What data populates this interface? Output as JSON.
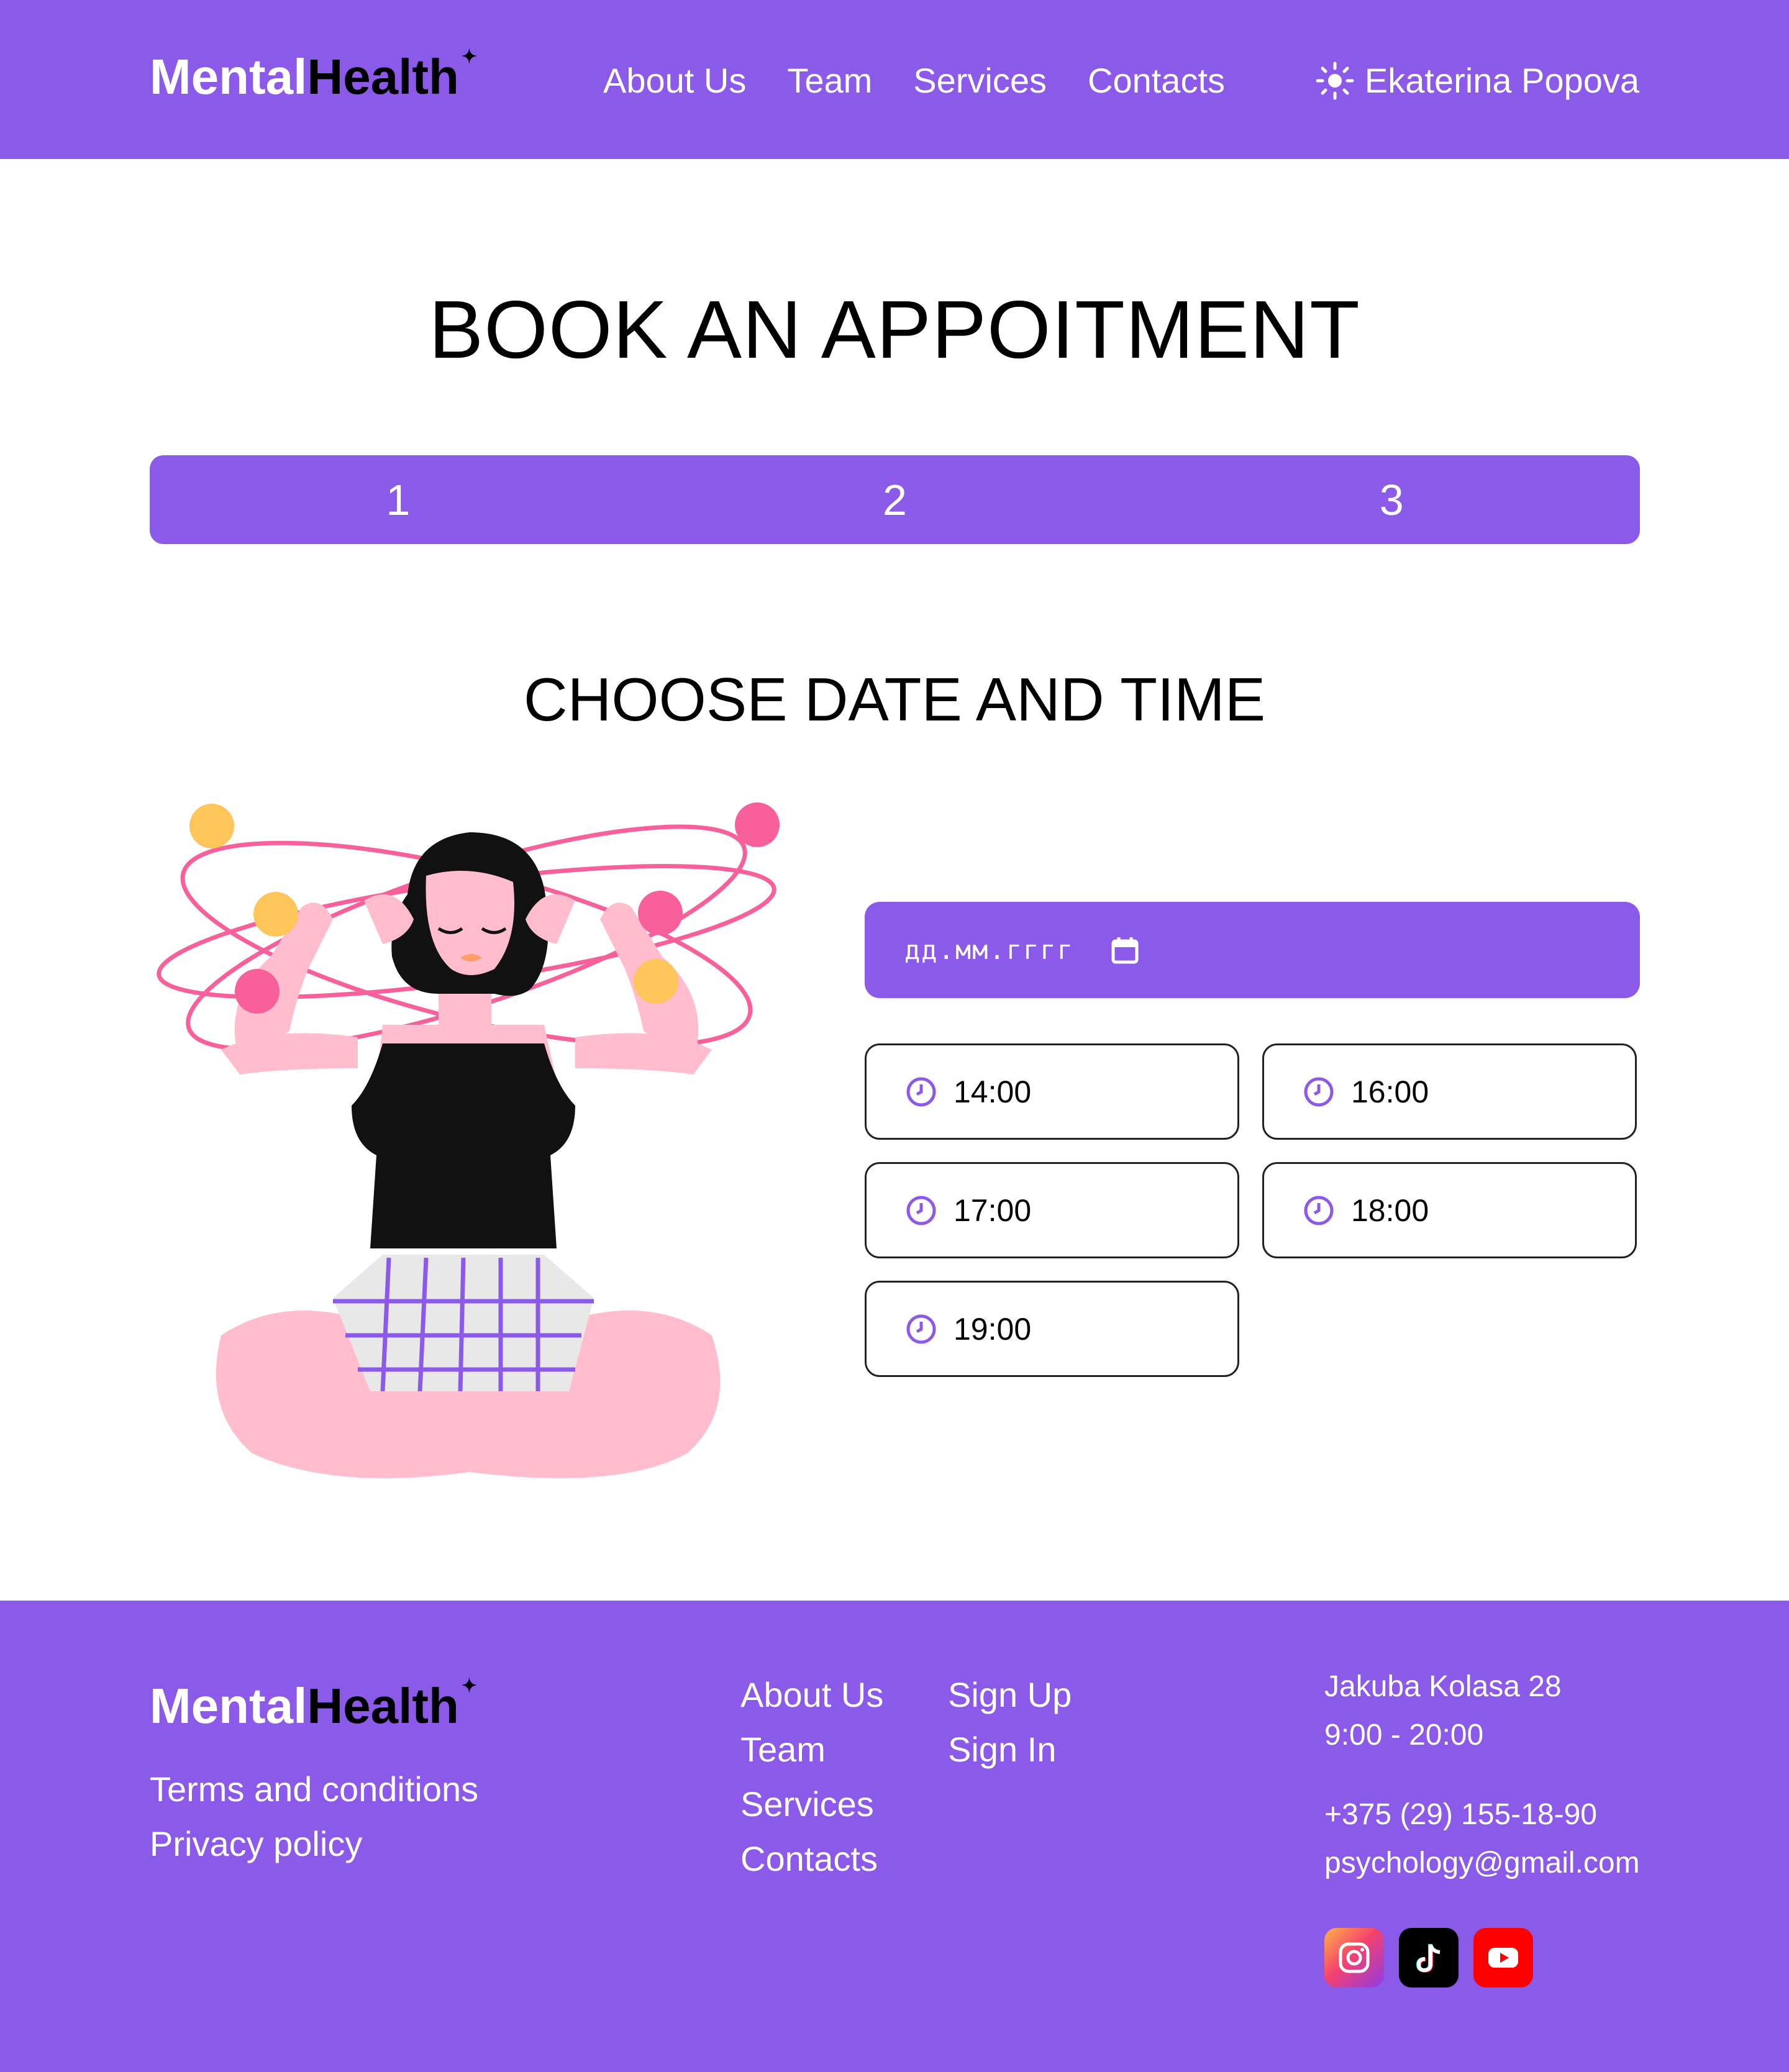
{
  "brand": {
    "part1": "Mental",
    "part2": "Health",
    "star": "✦"
  },
  "nav": [
    {
      "label": "About Us"
    },
    {
      "label": "Team"
    },
    {
      "label": "Services"
    },
    {
      "label": "Contacts"
    }
  ],
  "user": {
    "name": "Ekaterina Popova",
    "icon": "sun-icon"
  },
  "page": {
    "title": "BOOK AN APPOITMENT",
    "steps": [
      "1",
      "2",
      "3"
    ],
    "section_title": "CHOOSE DATE AND TIME"
  },
  "date_input": {
    "placeholder": "дд.мм.гггг",
    "icon": "calendar-icon"
  },
  "time_slots": [
    "14:00",
    "16:00",
    "17:00",
    "18:00",
    "19:00"
  ],
  "footer": {
    "legal": [
      "Terms and conditions",
      "Privacy policy"
    ],
    "links_col1": [
      "About Us",
      "Team",
      "Services",
      "Contacts"
    ],
    "links_col2": [
      "Sign Up",
      "Sign In"
    ],
    "address": "Jakuba Kolasa 28",
    "hours": "9:00 - 20:00",
    "phone": "+375 (29) 155-18-90",
    "email": "psychology@gmail.com",
    "socials": [
      "instagram-icon",
      "tiktok-icon",
      "youtube-icon"
    ]
  },
  "colors": {
    "accent": "#8b5ae8",
    "pink": "#f7609a",
    "yellow": "#fdc55a",
    "skin": "#ffbdcd"
  }
}
